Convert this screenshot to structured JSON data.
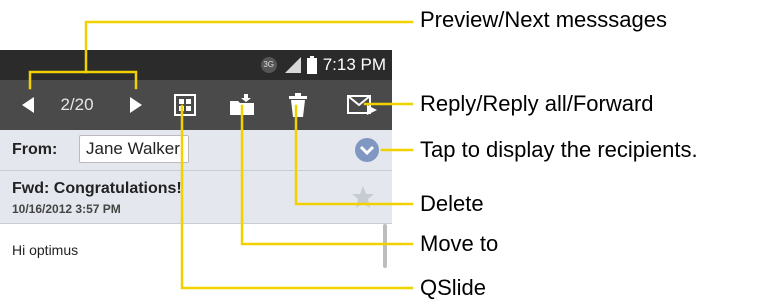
{
  "status_bar": {
    "network_badge": "3G",
    "time": "7:13 PM"
  },
  "action_bar": {
    "counter": "2/20",
    "icons": [
      "prev-arrow-icon",
      "next-arrow-icon",
      "qslide-icon",
      "move-folder-icon",
      "trash-icon",
      "reply-mail-icon"
    ]
  },
  "header": {
    "from_label": "From:",
    "from_name": "Jane Walker"
  },
  "message": {
    "subject": "Fwd: Congratulations!",
    "date": "10/16/2012 3:57 PM",
    "body": "Hi optimus"
  },
  "callouts": {
    "preview_next": "Preview/Next messsages",
    "reply": "Reply/Reply all/Forward",
    "recipients": "Tap to display the recipients.",
    "delete": "Delete",
    "move_to": "Move to",
    "qslide": "QSlide"
  },
  "colors": {
    "callout_line": "#f2d100",
    "status_bar": "#2b2b2b",
    "action_bar": "#4a4a4a",
    "header_bg": "#e4e8ee",
    "expand_button": "#7f97c1"
  }
}
